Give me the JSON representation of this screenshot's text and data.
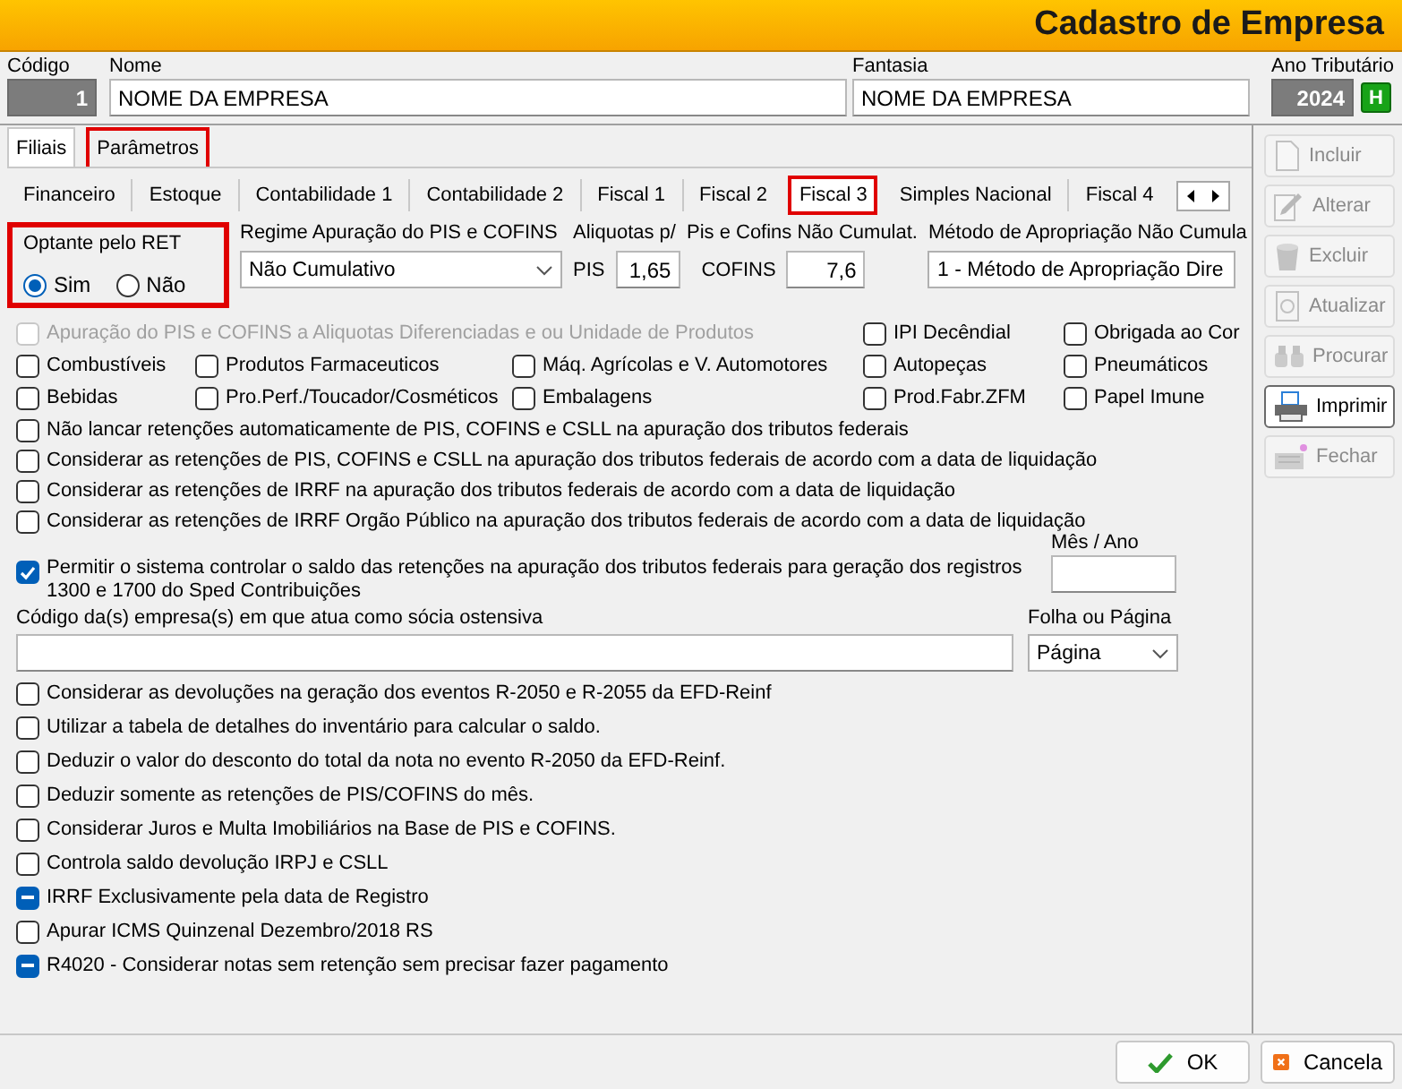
{
  "window": {
    "title": "Cadastro de Empresa"
  },
  "header": {
    "codigo": {
      "label": "Código",
      "value": "1"
    },
    "nome": {
      "label": "Nome",
      "value": "NOME DA EMPRESA"
    },
    "fantasia": {
      "label": "Fantasia",
      "value": "NOME DA EMPRESA"
    },
    "ano": {
      "label": "Ano Tributário",
      "value": "2024",
      "button": "H"
    }
  },
  "tabs": [
    {
      "label": "Filiais",
      "selected": true,
      "highlighted": false
    },
    {
      "label": "Parâmetros",
      "selected": false,
      "highlighted": true
    }
  ],
  "subtabs": [
    {
      "label": "Financeiro",
      "selected": false,
      "highlighted": false
    },
    {
      "label": "Estoque",
      "selected": false,
      "highlighted": false
    },
    {
      "label": "Contabilidade 1",
      "selected": false,
      "highlighted": false
    },
    {
      "label": "Contabilidade 2",
      "selected": false,
      "highlighted": false
    },
    {
      "label": "Fiscal 1",
      "selected": false,
      "highlighted": false
    },
    {
      "label": "Fiscal 2",
      "selected": false,
      "highlighted": false
    },
    {
      "label": "Fiscal 3",
      "selected": true,
      "highlighted": true
    },
    {
      "label": "Simples Nacional",
      "selected": false,
      "highlighted": false
    },
    {
      "label": "Fiscal 4",
      "selected": false,
      "highlighted": false
    }
  ],
  "ret": {
    "label": "Optante pelo RET",
    "highlighted": true,
    "options": [
      {
        "label": "Sim",
        "selected": true
      },
      {
        "label": "Não",
        "selected": false
      }
    ]
  },
  "regime": {
    "label": "Regime Apuração do PIS e COFINS",
    "value": "Não Cumulativo"
  },
  "aliquotas": {
    "label": "Aliquotas p/",
    "label2": "Pis e Cofins Não Cumulat.",
    "pis_label": "PIS",
    "pis_value": "1,65",
    "cofins_label": "COFINS",
    "cofins_value": "7,6"
  },
  "metodo": {
    "label": "Método de Apropriação Não Cumula",
    "value": "1 - Método de Apropriação Dire"
  },
  "products": [
    {
      "label": "Apuração do PIS e COFINS a Aliquotas Diferenciadas e ou Unidade de Produtos",
      "kind": "wide",
      "checked": false,
      "disabled": true
    },
    {
      "label": "IPI Decêndial",
      "kind": "normal",
      "checked": false,
      "disabled": false
    },
    {
      "label": "Obrigada ao Cor",
      "kind": "normal",
      "checked": false,
      "disabled": false
    },
    {
      "label": "Combustíveis",
      "kind": "normal",
      "checked": false,
      "disabled": false
    },
    {
      "label": "Produtos Farmaceuticos",
      "kind": "normal",
      "checked": false,
      "disabled": false
    },
    {
      "label": "Máq. Agrícolas e V. Automotores",
      "kind": "normal",
      "checked": false,
      "disabled": false
    },
    {
      "label": "Autopeças",
      "kind": "normal",
      "checked": false,
      "disabled": false
    },
    {
      "label": "Pneumáticos",
      "kind": "normal",
      "checked": false,
      "disabled": false
    },
    {
      "label": "Bebidas",
      "kind": "normal",
      "checked": false,
      "disabled": false
    },
    {
      "label": "Pro.Perf./Toucador/Cosméticos",
      "kind": "normal",
      "checked": false,
      "disabled": false
    },
    {
      "label": "Embalagens",
      "kind": "normal",
      "checked": false,
      "disabled": false
    },
    {
      "label": "Prod.Fabr.ZFM",
      "kind": "normal",
      "checked": false,
      "disabled": false
    },
    {
      "label": "Papel Imune",
      "kind": "normal",
      "checked": false,
      "disabled": false
    }
  ],
  "retencoes": [
    {
      "label": "Não lancar retenções automaticamente de PIS, COFINS e CSLL na apuração dos tributos federais",
      "checked": false
    },
    {
      "label": "Considerar as retenções de PIS, COFINS e CSLL na apuração dos tributos federais de acordo com a data de liquidação",
      "checked": false
    },
    {
      "label": "Considerar as retenções de IRRF na apuração dos tributos federais de acordo com a data de liquidação",
      "checked": false
    },
    {
      "label": "Considerar as retenções de IRRF Orgão Público na apuração dos tributos federais de acordo com a data de liquidação",
      "checked": false
    }
  ],
  "saldo": {
    "label": "Permitir o sistema controlar o saldo das retenções na apuração dos tributos federais para geração dos registros 1300 e 1700 do Sped Contribuições",
    "checked": true
  },
  "mes_ano": {
    "label": "Mês / Ano"
  },
  "socia": {
    "label": "Código da(s) empresa(s) em que atua como sócia ostensiva"
  },
  "folha": {
    "label": "Folha ou Página",
    "value": "Página"
  },
  "options": [
    {
      "label": "Considerar as devoluções na geração dos eventos R-2050 e R-2055 da EFD-Reinf",
      "checked": false,
      "partial": false
    },
    {
      "label": "Utilizar a tabela de detalhes do inventário para calcular o saldo.",
      "checked": false,
      "partial": false
    },
    {
      "label": "Deduzir o valor do desconto do total da nota no evento R-2050 da EFD-Reinf.",
      "checked": false,
      "partial": false
    },
    {
      "label": "Deduzir somente as retenções de PIS/COFINS do mês.",
      "checked": false,
      "partial": false
    },
    {
      "label": "Considerar Juros e Multa Imobiliários na Base de PIS e COFINS.",
      "checked": false,
      "partial": false
    },
    {
      "label": "Controla saldo devolução IRPJ e CSLL",
      "checked": false,
      "partial": false
    },
    {
      "label": "IRRF Exclusivamente pela data de Registro",
      "checked": false,
      "partial": true
    },
    {
      "label": "Apurar ICMS Quinzenal Dezembro/2018 RS",
      "checked": false,
      "partial": false
    },
    {
      "label": "R4020 - Considerar notas sem retenção sem precisar fazer pagamento",
      "checked": false,
      "partial": true
    }
  ],
  "toolbar": [
    {
      "label": "Incluir",
      "disabled": true,
      "focused": false
    },
    {
      "label": "Alterar",
      "disabled": true,
      "focused": false
    },
    {
      "label": "Excluir",
      "disabled": true,
      "focused": false
    },
    {
      "label": "Atualizar",
      "disabled": true,
      "focused": false
    },
    {
      "label": "Procurar",
      "disabled": true,
      "focused": false
    },
    {
      "label": "Imprimir",
      "disabled": false,
      "focused": true
    },
    {
      "label": "Fechar",
      "disabled": true,
      "focused": false
    }
  ],
  "footer": [
    {
      "label": "OK",
      "kind": "ok"
    },
    {
      "label": "Cancela",
      "kind": "cancel"
    }
  ]
}
